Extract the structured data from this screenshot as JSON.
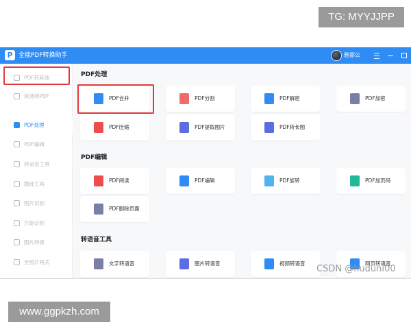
{
  "tg_badge": "TG: MYYJJPP",
  "url_badge": "www.ggpkzh.com",
  "watermark": "CSDN @huduni00",
  "window": {
    "title": "全能PDF转换助手",
    "logo_glyph": "P",
    "user_name": "雅娜公",
    "accent_color": "#2f8cf5"
  },
  "sidebar": {
    "items": [
      {
        "label": "PDF转其他",
        "active": false
      },
      {
        "label": "其他转PDF",
        "active": false
      },
      {
        "label": "PDF处理",
        "active": true
      },
      {
        "label": "PDF编辑",
        "active": false
      },
      {
        "label": "转语音工具",
        "active": false
      },
      {
        "label": "翻译工具",
        "active": false
      },
      {
        "label": "图片识别",
        "active": false
      },
      {
        "label": "万能识别",
        "active": false
      },
      {
        "label": "图片转换",
        "active": false
      },
      {
        "label": "全图片格式",
        "active": false
      }
    ]
  },
  "sections": {
    "pdf_process": {
      "title": "PDF处理",
      "tools": [
        {
          "label": "PDF合并",
          "icon": "merge-icon",
          "color": "#2f8cf5"
        },
        {
          "label": "PDF分割",
          "icon": "split-icon",
          "color": "#f26b6b"
        },
        {
          "label": "PDF解密",
          "icon": "unlock-icon",
          "color": "#2f8cf5"
        },
        {
          "label": "PDF加密",
          "icon": "lock-icon",
          "color": "#7a7fa8"
        },
        {
          "label": "PDF压缩",
          "icon": "compress-icon",
          "color": "#ef4d4d"
        },
        {
          "label": "PDF提取图片",
          "icon": "image-extract-icon",
          "color": "#5b6ee1"
        },
        {
          "label": "PDF转长图",
          "icon": "long-image-icon",
          "color": "#5b6ee1"
        }
      ]
    },
    "pdf_edit": {
      "title": "PDF编辑",
      "tools": [
        {
          "label": "PDF阅读",
          "icon": "read-icon",
          "color": "#ef4d4d"
        },
        {
          "label": "PDF编辑",
          "icon": "edit-icon",
          "color": "#2f8cf5"
        },
        {
          "label": "PDF旋转",
          "icon": "rotate-icon",
          "color": "#4fb3f0"
        },
        {
          "label": "PDF加页码",
          "icon": "page-number-icon",
          "color": "#23b89a"
        },
        {
          "label": "PDF删除页面",
          "icon": "delete-page-icon",
          "color": "#7a7fa8"
        }
      ]
    },
    "voice_tools": {
      "title": "转语音工具",
      "tools": [
        {
          "label": "文字转语音",
          "icon": "text-voice-icon",
          "color": "#7a7fa8"
        },
        {
          "label": "图片转语音",
          "icon": "image-voice-icon",
          "color": "#5b6ee1"
        },
        {
          "label": "视频转语音",
          "icon": "video-voice-icon",
          "color": "#2f8cf5"
        },
        {
          "label": "网页转语音",
          "icon": "web-voice-icon",
          "color": "#2f8cf5"
        }
      ]
    }
  },
  "highlight_color": "#e0393b"
}
